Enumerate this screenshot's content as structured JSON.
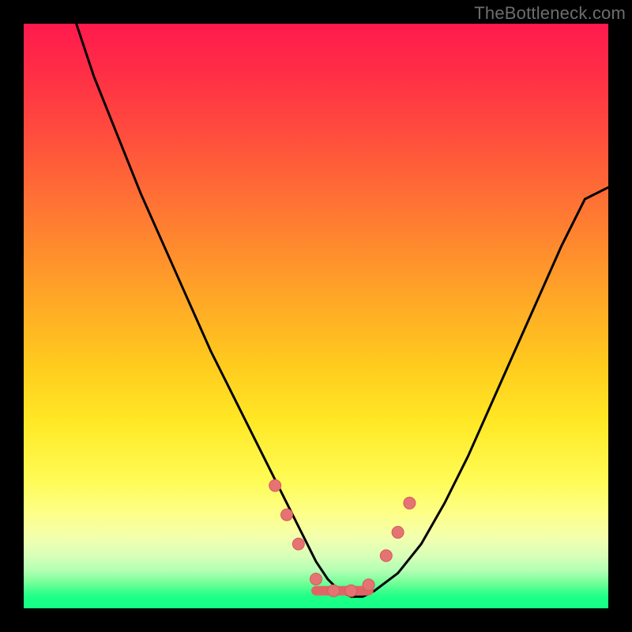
{
  "watermark": "TheBottleneck.com",
  "chart_data": {
    "type": "line",
    "title": "",
    "xlabel": "",
    "ylabel": "",
    "xlim": [
      0,
      100
    ],
    "ylim": [
      0,
      100
    ],
    "gradient_stops": [
      {
        "pos": 0,
        "meaning": "bad",
        "color": "#ff1a4d"
      },
      {
        "pos": 50,
        "meaning": "mid",
        "color": "#ffca1e"
      },
      {
        "pos": 95,
        "meaning": "good",
        "color": "#3fff8e"
      },
      {
        "pos": 100,
        "meaning": "best",
        "color": "#13ff85"
      }
    ],
    "series": [
      {
        "name": "bottleneck-curve",
        "x": [
          9,
          12,
          16,
          20,
          24,
          28,
          32,
          36,
          40,
          44,
          48,
          50,
          52,
          54,
          56,
          58,
          60,
          64,
          68,
          72,
          76,
          80,
          84,
          88,
          92,
          96,
          100
        ],
        "y_pct": [
          100,
          91,
          81,
          71,
          62,
          53,
          44,
          36,
          28,
          20,
          12,
          8,
          5,
          3,
          2,
          2,
          3,
          6,
          11,
          18,
          26,
          35,
          44,
          53,
          62,
          70,
          72
        ]
      }
    ],
    "markers": [
      {
        "name": "marker-left-1",
        "x": 43,
        "y_pct": 21
      },
      {
        "name": "marker-left-2",
        "x": 45,
        "y_pct": 16
      },
      {
        "name": "marker-left-3",
        "x": 47,
        "y_pct": 11
      },
      {
        "name": "marker-flat-1",
        "x": 50,
        "y_pct": 5
      },
      {
        "name": "marker-flat-2",
        "x": 53,
        "y_pct": 3
      },
      {
        "name": "marker-flat-3",
        "x": 56,
        "y_pct": 3
      },
      {
        "name": "marker-flat-4",
        "x": 59,
        "y_pct": 4
      },
      {
        "name": "marker-right-1",
        "x": 62,
        "y_pct": 9
      },
      {
        "name": "marker-right-2",
        "x": 64,
        "y_pct": 13
      },
      {
        "name": "marker-right-3",
        "x": 66,
        "y_pct": 18
      }
    ],
    "flat_segment": {
      "x_start": 50,
      "x_end": 59,
      "y_pct": 3
    },
    "colors": {
      "curve": "#000000",
      "marker_fill": "#e57373",
      "marker_stroke": "#d55a5a",
      "flat_stroke": "#e06666"
    }
  }
}
